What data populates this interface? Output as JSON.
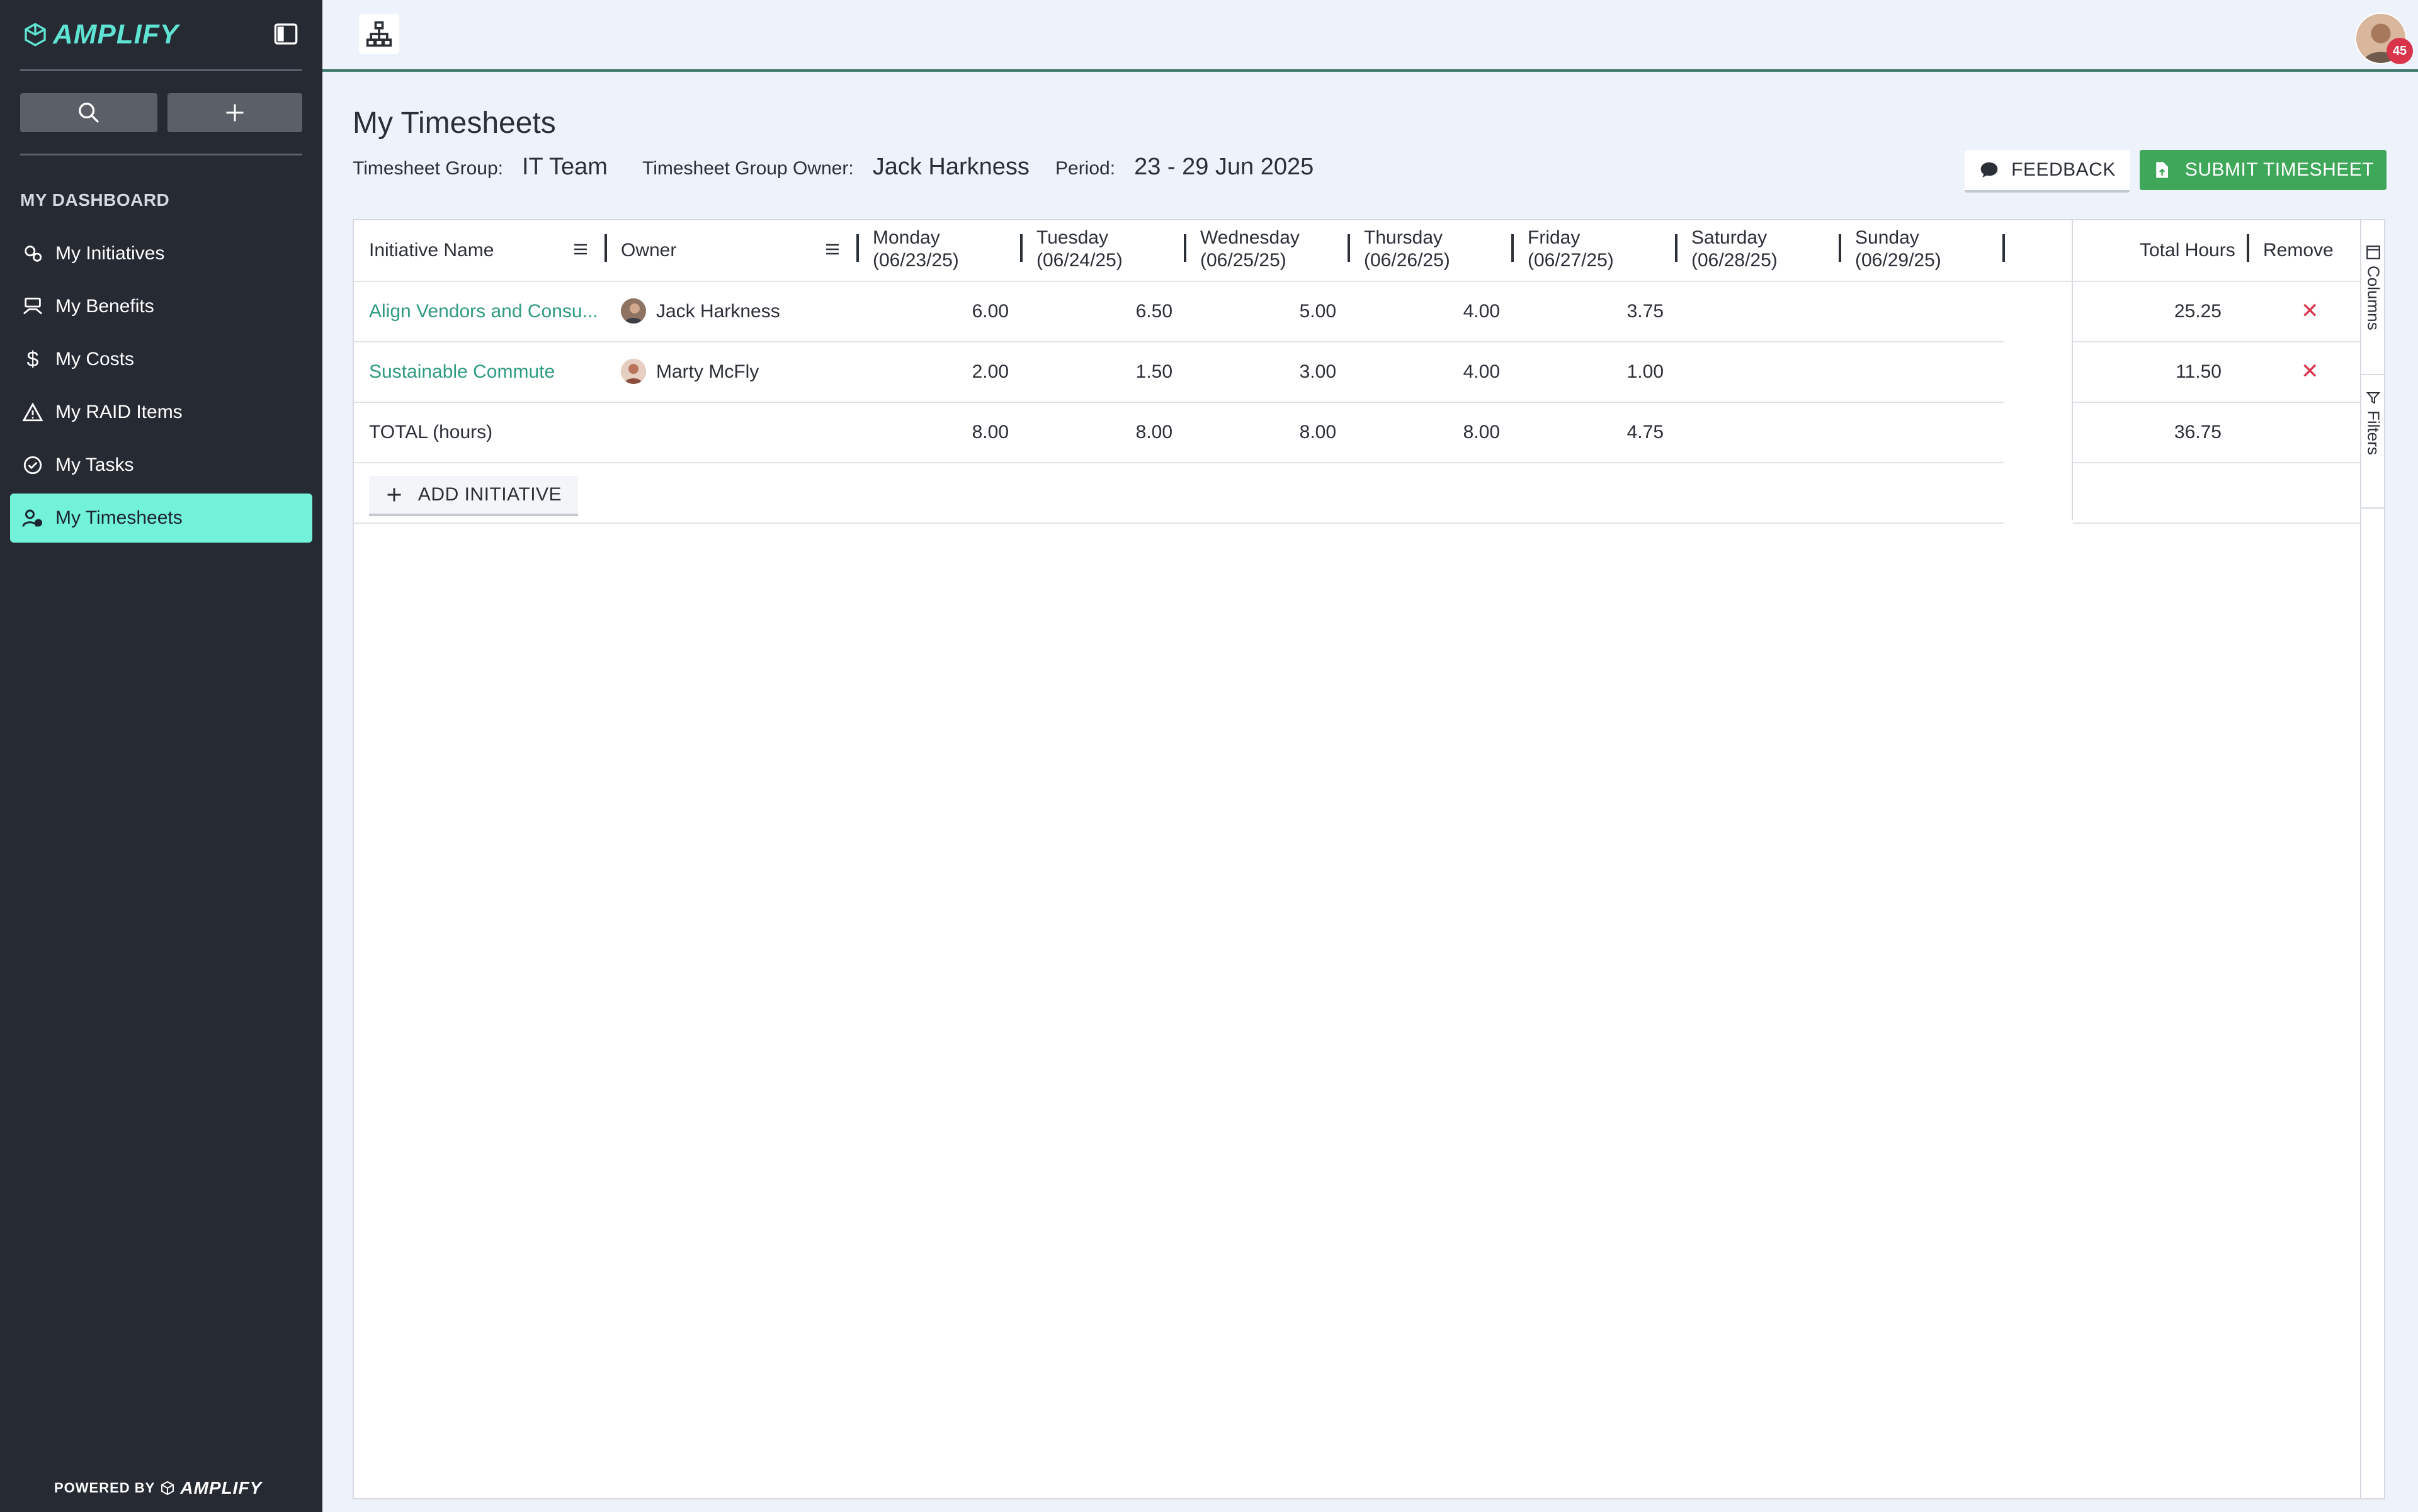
{
  "app": {
    "brand": "AMPLIFY",
    "powered_by": "POWERED BY",
    "powered_brand": "AMPLIFY"
  },
  "sidebar": {
    "section_title": "MY DASHBOARD",
    "items": [
      {
        "label": "My Initiatives",
        "icon": "initiatives-icon"
      },
      {
        "label": "My Benefits",
        "icon": "benefits-icon"
      },
      {
        "label": "My Costs",
        "icon": "dollar-icon"
      },
      {
        "label": "My RAID Items",
        "icon": "warning-icon"
      },
      {
        "label": "My Tasks",
        "icon": "check-circle-icon"
      },
      {
        "label": "My Timesheets",
        "icon": "user-clock-icon",
        "active": true
      }
    ]
  },
  "topbar": {
    "notification_count": "45"
  },
  "page": {
    "title": "My Timesheets",
    "group_label": "Timesheet Group:",
    "group_value": "IT Team",
    "owner_label": "Timesheet Group Owner:",
    "owner_value": "Jack Harkness",
    "period_label": "Period:",
    "period_value": "23 - 29 Jun 2025",
    "feedback_label": "FEEDBACK",
    "submit_label": "SUBMIT TIMESHEET"
  },
  "grid": {
    "col_initiative": "Initiative Name",
    "col_owner": "Owner",
    "days": [
      {
        "name": "Monday",
        "date": "(06/23/25)"
      },
      {
        "name": "Tuesday",
        "date": "(06/24/25)"
      },
      {
        "name": "Wednesday",
        "date": "(06/25/25)"
      },
      {
        "name": "Thursday",
        "date": "(06/26/25)"
      },
      {
        "name": "Friday",
        "date": "(06/27/25)"
      },
      {
        "name": "Saturday",
        "date": "(06/28/25)"
      },
      {
        "name": "Sunday",
        "date": "(06/29/25)"
      }
    ],
    "col_total": "Total Hours",
    "col_remove": "Remove",
    "rows": [
      {
        "initiative": "Align Vendors and Consu...",
        "owner": "Jack Harkness",
        "hours": [
          "6.00",
          "6.50",
          "5.00",
          "4.00",
          "3.75",
          "",
          ""
        ],
        "total": "25.25",
        "remove": "✕"
      },
      {
        "initiative": "Sustainable Commute",
        "owner": "Marty McFly",
        "hours": [
          "2.00",
          "1.50",
          "3.00",
          "4.00",
          "1.00",
          "",
          ""
        ],
        "total": "11.50",
        "remove": "✕"
      }
    ],
    "total_row": {
      "label": "TOTAL (hours)",
      "hours": [
        "8.00",
        "8.00",
        "8.00",
        "8.00",
        "4.75",
        "",
        ""
      ],
      "total": "36.75"
    },
    "add_label": "ADD INITIATIVE",
    "side_tabs": {
      "columns": "Columns",
      "filters": "Filters"
    }
  }
}
